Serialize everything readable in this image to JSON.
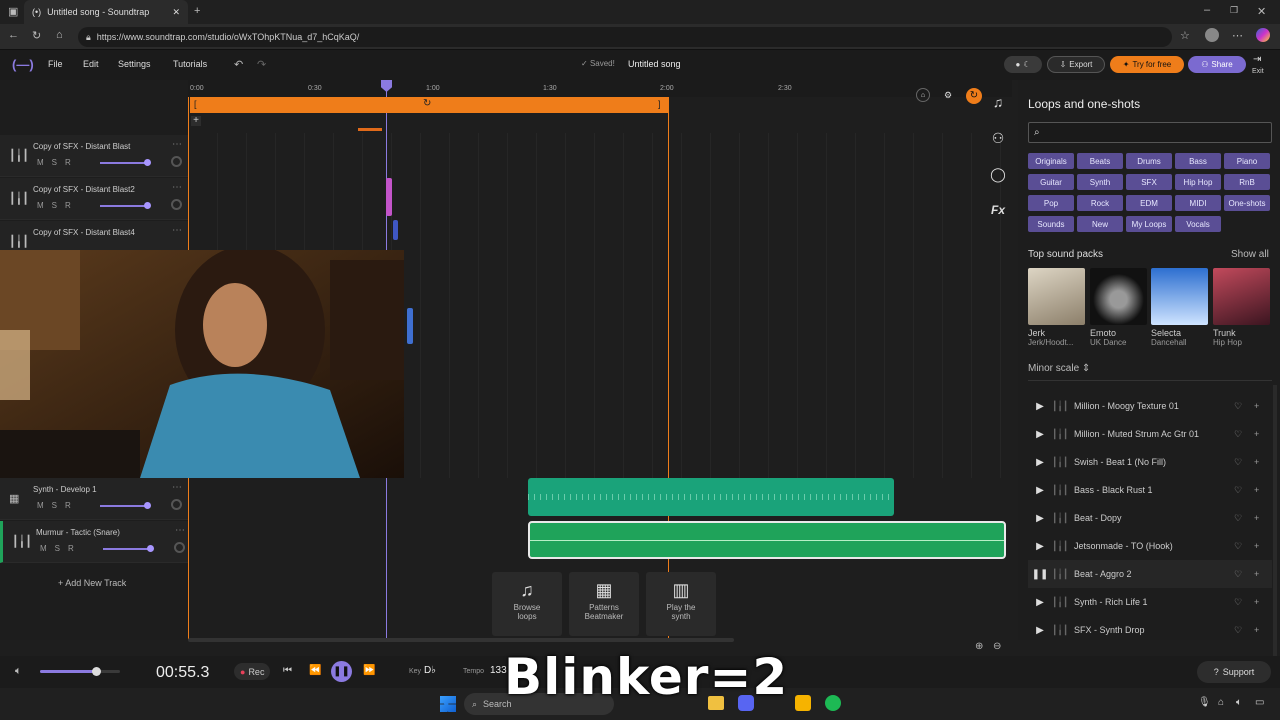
{
  "browser": {
    "tab_title": "Untitled song - Soundtrap",
    "url": "https://www.soundtrap.com/studio/oWxTOhpKTNua_d7_hCqKaQ/"
  },
  "app": {
    "menu": [
      "File",
      "Edit",
      "Settings",
      "Tutorials"
    ],
    "saved_label": "Saved!",
    "song_title": "Untitled song",
    "export_label": "Export",
    "try_label": "Try for free",
    "share_label": "Share",
    "exit_label": "Exit"
  },
  "ruler": [
    "0:00",
    "0:30",
    "1:00",
    "1:30",
    "2:00",
    "2:30"
  ],
  "tracks": [
    {
      "name": "Copy of SFX - Distant Blast"
    },
    {
      "name": "Copy of SFX - Distant Blast2"
    },
    {
      "name": "Copy of SFX - Distant Blast4"
    },
    {
      "name": "Synth - Develop 1"
    },
    {
      "name": "Murmur - Tactic (Snare)"
    }
  ],
  "track_ctrl": [
    "M",
    "S",
    "R"
  ],
  "add_track_label": "+ Add New Track",
  "quick": [
    {
      "line1": "Browse",
      "line2": "loops"
    },
    {
      "line1": "Patterns",
      "line2": "Beatmaker"
    },
    {
      "line1": "Play the",
      "line2": "synth"
    }
  ],
  "panel": {
    "title": "Loops and one-shots",
    "chips": [
      "Originals",
      "Beats",
      "Drums",
      "Bass",
      "Piano",
      "Guitar",
      "Synth",
      "SFX",
      "Hip Hop",
      "RnB",
      "Pop",
      "Rock",
      "EDM",
      "MIDI",
      "One-shots",
      "Sounds",
      "New",
      "My Loops",
      "Vocals"
    ],
    "packs_title": "Top sound packs",
    "show_all": "Show all",
    "packs": [
      {
        "name": "Jerk",
        "genre": "Jerk/Hoodt..."
      },
      {
        "name": "Emoto",
        "genre": "UK Dance"
      },
      {
        "name": "Selecta",
        "genre": "Dancehall"
      },
      {
        "name": "Trunk",
        "genre": "Hip Hop"
      }
    ],
    "scale_label": "Minor scale",
    "loops": [
      "Million - Moogy Texture 01",
      "Million - Muted Strum Ac Gtr 01",
      "Swish - Beat 1 (No Fill)",
      "Bass - Black Rust 1",
      "Beat - Dopy",
      "Jetsonmade - TO (Hook)",
      "Beat - Aggro 2",
      "Synth - Rich Life 1",
      "SFX - Synth Drop"
    ]
  },
  "transport": {
    "time": "00:55.3",
    "rec_label": "Rec",
    "key_label": "Key",
    "key_value": "D♭",
    "tempo_label": "Tempo",
    "tempo_value": "133",
    "support_label": "Support"
  },
  "overlay": "Blinker=2",
  "taskbar": {
    "search_label": "Search"
  }
}
